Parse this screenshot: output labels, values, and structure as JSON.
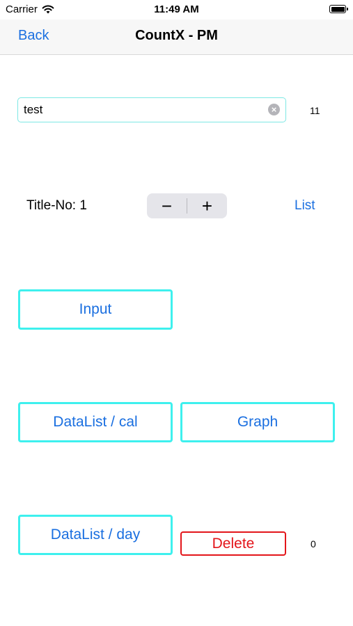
{
  "status_bar": {
    "carrier": "Carrier",
    "time": "11:49 AM"
  },
  "nav": {
    "back_label": "Back",
    "title": "CountX - PM"
  },
  "text_field": {
    "value": "test",
    "count": "11"
  },
  "title_row": {
    "label": "Title-No: 1",
    "stepper_minus": "−",
    "stepper_plus": "+",
    "list_label": "List"
  },
  "buttons": {
    "input": "Input",
    "datalist_cal": "DataList / cal",
    "graph": "Graph",
    "datalist_day": "DataList / day",
    "delete": "Delete"
  },
  "delete_count": "0",
  "colors": {
    "accent": "#1a6fe0",
    "button_border": "#3ef0ee",
    "delete": "#e3151a"
  }
}
